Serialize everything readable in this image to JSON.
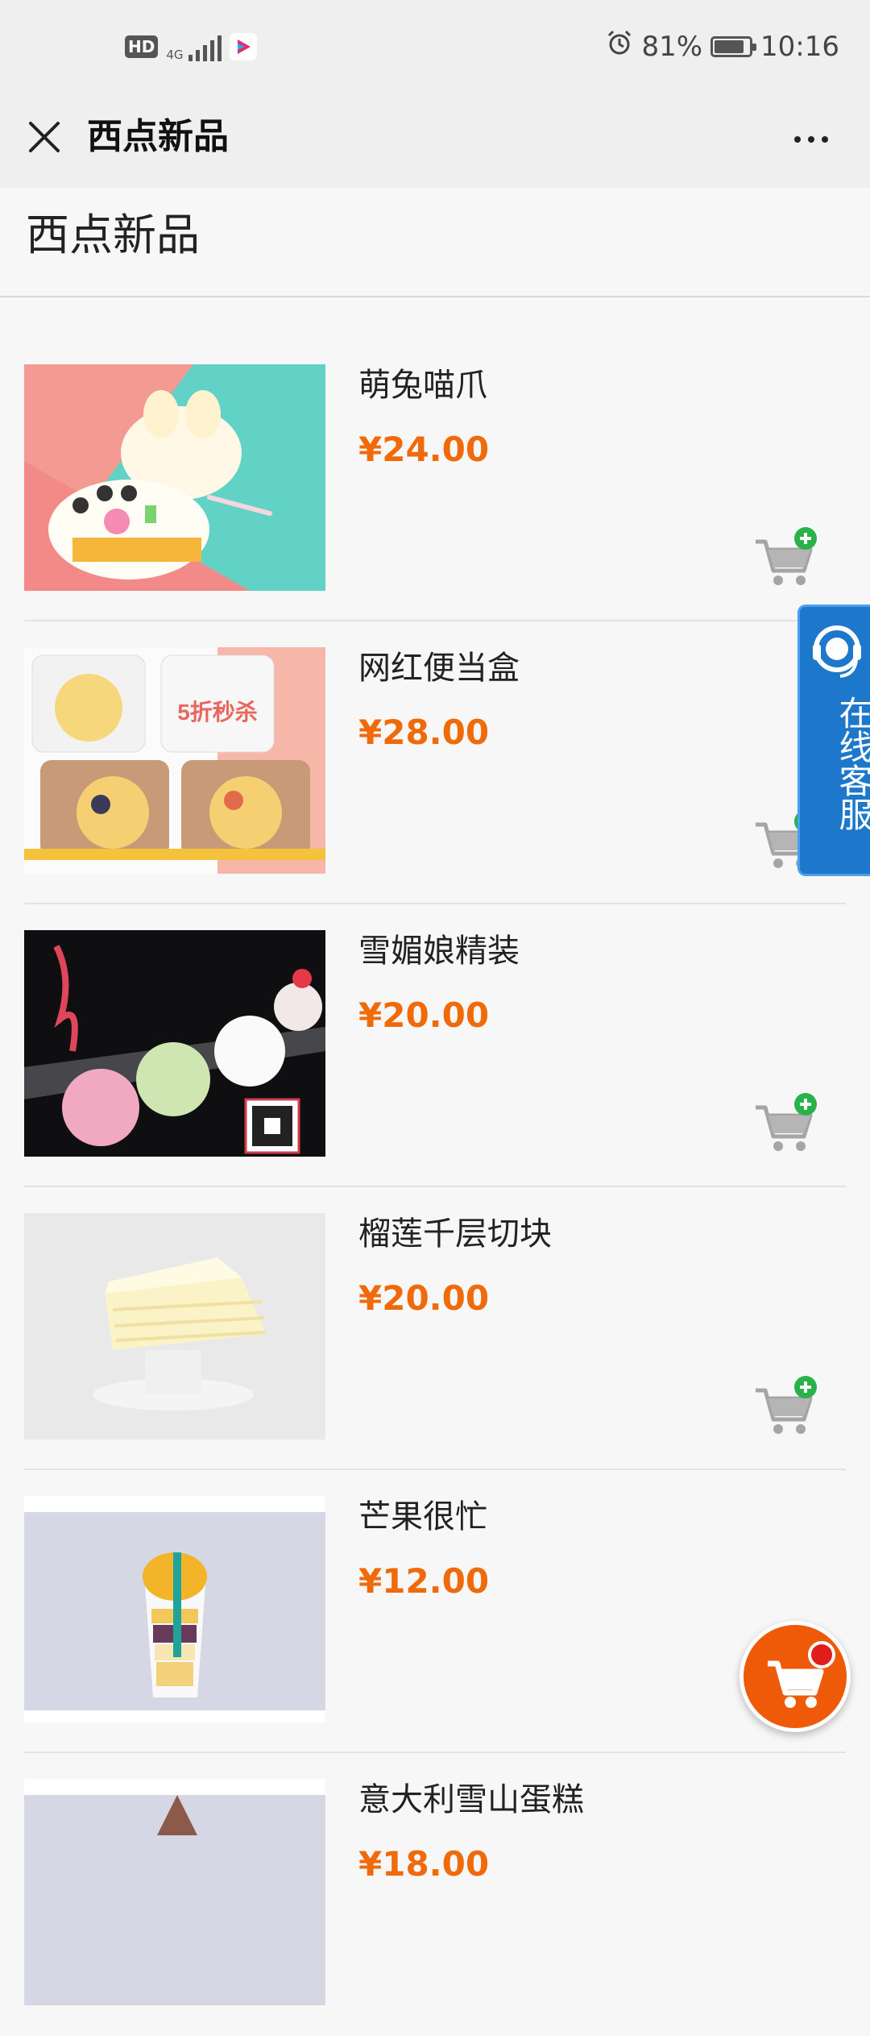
{
  "status_bar": {
    "hd": "HD",
    "network_top": "4G",
    "network_bottom": "4G",
    "battery": "81%",
    "time": "10:16",
    "icons": [
      "alarm-icon",
      "battery-icon",
      "signal-icon",
      "youku-app-icon"
    ]
  },
  "nav": {
    "title": "西点新品",
    "close_icon": "close-icon",
    "more_icon": "more-icon"
  },
  "category": {
    "title": "西点新品"
  },
  "products": [
    {
      "name": "萌兔喵爪",
      "price": "¥24.00"
    },
    {
      "name": "网红便当盒",
      "price": "¥28.00",
      "image_badge": "5折秒杀"
    },
    {
      "name": "雪媚娘精装",
      "price": "¥20.00"
    },
    {
      "name": "榴莲千层切块",
      "price": "¥20.00"
    },
    {
      "name": "芒果很忙",
      "price": "¥12.00"
    },
    {
      "name": "意大利雪山蛋糕",
      "price": "¥18.00"
    }
  ],
  "service": {
    "label": "在线客服"
  },
  "colors": {
    "price": "#f06a0a",
    "service_bg": "#1d78cc",
    "cart_fab": "#ee5a07",
    "add_badge": "#2ab24a"
  }
}
